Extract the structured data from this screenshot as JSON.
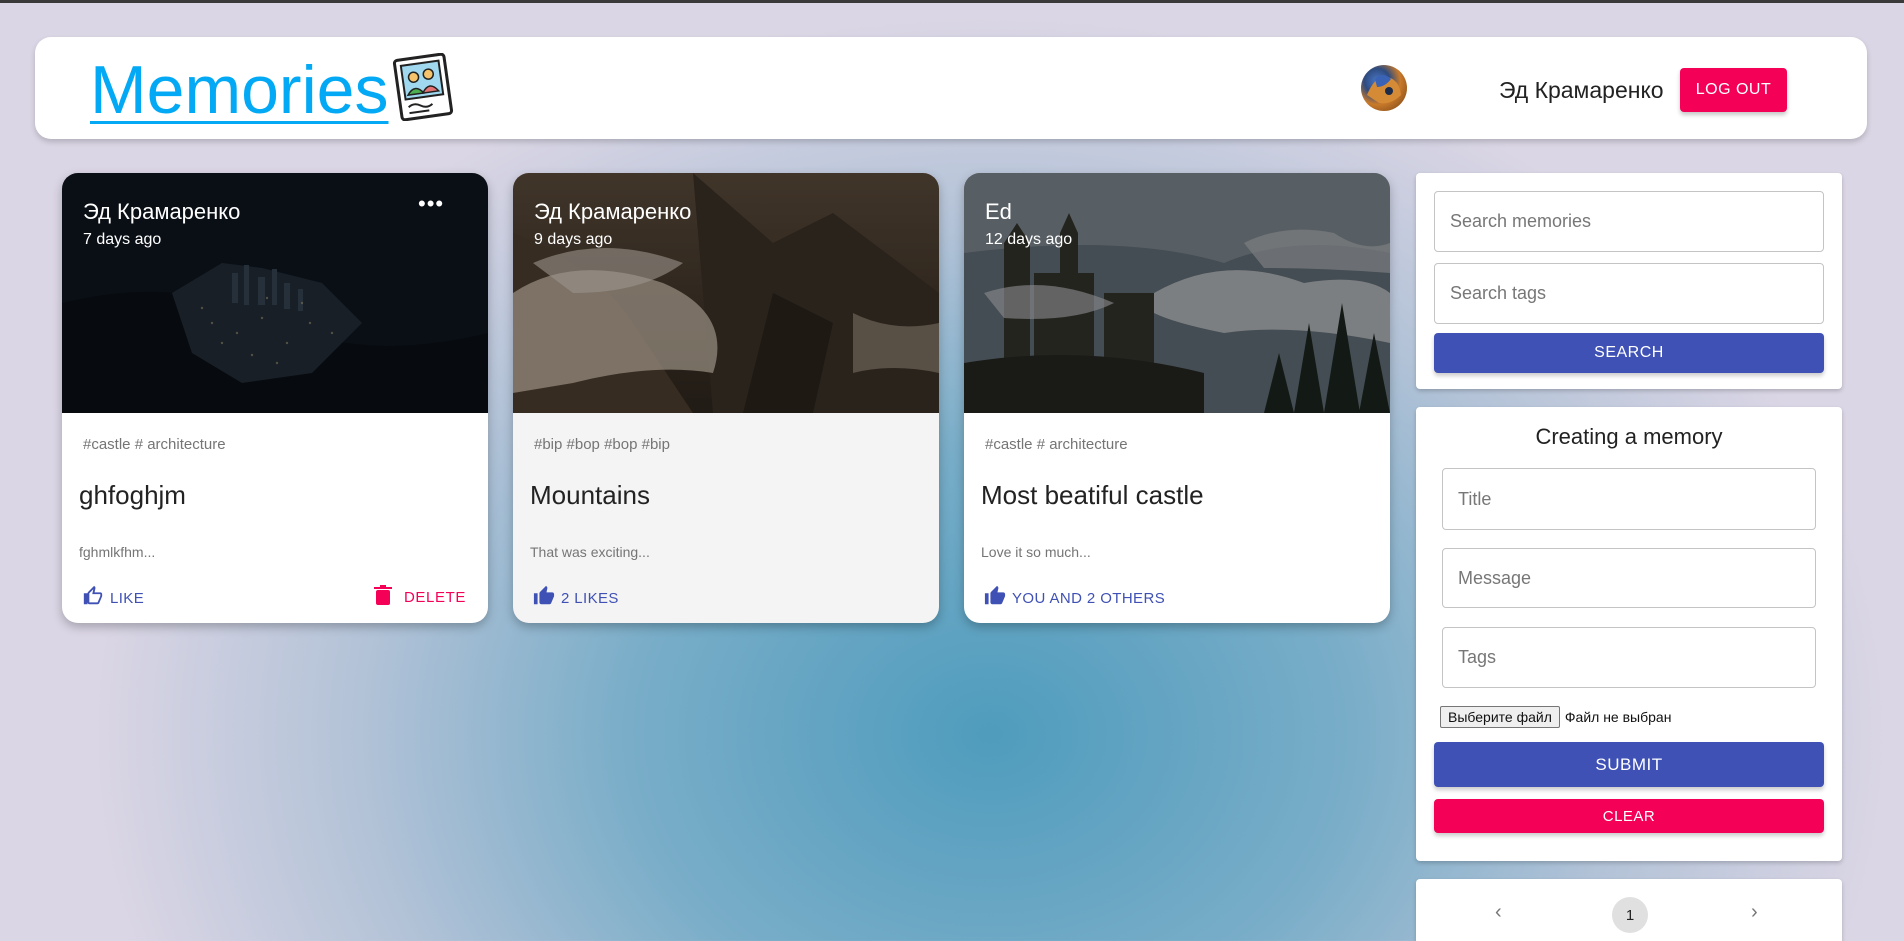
{
  "header": {
    "brand": "Memories",
    "logo_icon": "memories-photo-icon",
    "user_name": "Эд Крамаренко",
    "logout_label": "LOG OUT"
  },
  "posts": [
    {
      "author": "Эд Крамаренко",
      "time": "7 days ago",
      "more": "•••",
      "tags": "#castle # architecture",
      "title": "ghfoghjm",
      "message": "fghmlkfhm...",
      "like_label": "LIKE",
      "delete_label": "DELETE"
    },
    {
      "author": "Эд Крамаренко",
      "time": "9 days ago",
      "tags": "#bip #bop #bop #bip",
      "title": "Mountains",
      "message": "That was exciting...",
      "like_label": "2 LIKES"
    },
    {
      "author": "Ed",
      "time": "12 days ago",
      "tags": "#castle # architecture",
      "title": "Most beatiful castle",
      "message": "Love it so much...",
      "like_label": "YOU AND 2 OTHERS"
    }
  ],
  "search": {
    "memories_placeholder": "Search memories",
    "tags_placeholder": "Search tags",
    "button_label": "SEARCH"
  },
  "form": {
    "title": "Creating a memory",
    "title_placeholder": "Title",
    "message_placeholder": "Message",
    "tags_placeholder": "Tags",
    "file_button": "Выберите файл",
    "file_status": "Файл не выбран",
    "submit_label": "SUBMIT",
    "clear_label": "CLEAR"
  },
  "pagination": {
    "prev": "‹",
    "page": "1",
    "next": "›"
  },
  "colors": {
    "primary": "#3f51b5",
    "secondary": "#f50057",
    "brand": "#03a9f4"
  }
}
